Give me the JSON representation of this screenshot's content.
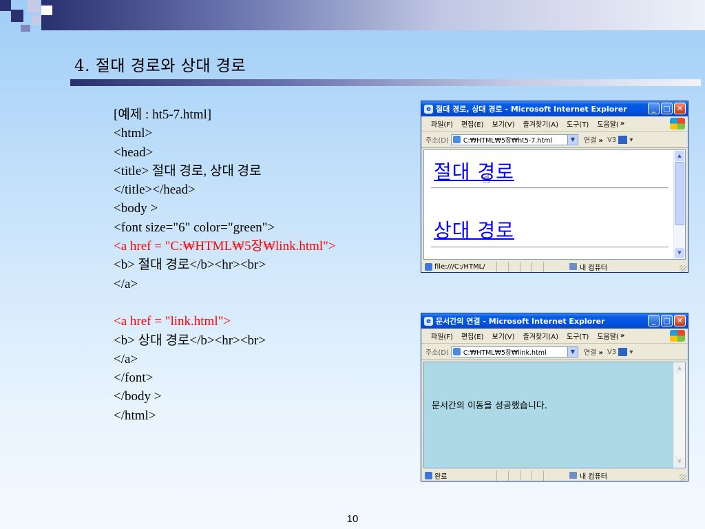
{
  "slide": {
    "title": "4. 절대 경로와 상대 경로",
    "page_number": "10"
  },
  "code_lines": [
    {
      "text": "[예제 : ht5-7.html]",
      "color": "#000000"
    },
    {
      "text": "<html>",
      "color": "#000000"
    },
    {
      "text": "<head>",
      "color": "#000000"
    },
    {
      "text": "<title> 절대 경로, 상대 경로",
      "color": "#000000"
    },
    {
      "text": "</title></head>",
      "color": "#000000"
    },
    {
      "text": "<body >",
      "color": "#000000"
    },
    {
      "text": "<font size=\"6\" color=\"green\">",
      "color": "#000000"
    },
    {
      "text": "<a href = \"C:₩HTML₩5장₩link.html\">",
      "color": "#ff0000"
    },
    {
      "text": "<b> 절대 경로</b><hr><br>",
      "color": "#000000"
    },
    {
      "text": "</a>",
      "color": "#000000"
    },
    {
      "text": "",
      "color": "#000000"
    },
    {
      "text": "<a href = \"link.html\">",
      "color": "#ff0000"
    },
    {
      "text": "<b> 상대 경로</b><hr><br>",
      "color": "#000000"
    },
    {
      "text": "</a>",
      "color": "#000000"
    },
    {
      "text": "</font>",
      "color": "#000000"
    },
    {
      "text": "</body >",
      "color": "#000000"
    },
    {
      "text": "</html>",
      "color": "#000000"
    }
  ],
  "window1": {
    "title": "절대 경로, 상대 경로 - Microsoft Internet Explorer",
    "menu": [
      "파일(F)",
      "편집(E)",
      "보기(V)",
      "즐겨찾기(A)",
      "도구(T)",
      "도움말("
    ],
    "menu_more": "»",
    "address_label": "주소(D)",
    "address_value": "C:₩HTML₩5장₩ht5-7.html",
    "links_label": "연결",
    "links_more": "»",
    "v3_label": "V3",
    "link1": "절대 경로",
    "link2": "상대 경로",
    "status_text": "file:///C:/HTML/",
    "status_zone": "내 컴퓨터"
  },
  "window2": {
    "title": "문서간의 연결 - Microsoft Internet Explorer",
    "menu": [
      "파일(F)",
      "편집(E)",
      "보기(V)",
      "즐겨찾기(A)",
      "도구(T)",
      "도움말("
    ],
    "menu_more": "»",
    "address_label": "주소(D)",
    "address_value": "C:₩HTML₩5장₩link.html",
    "links_label": "연결",
    "links_more": "»",
    "v3_label": "V3",
    "body_text": "문서간의 이동을 성공했습니다.",
    "content_bg": "#add8e6",
    "status_text": "완료",
    "status_zone": "내 컴퓨터"
  },
  "colors": {
    "accent_dark": "#29306e",
    "link": "#0000ff",
    "code_highlight": "#ff0000"
  }
}
